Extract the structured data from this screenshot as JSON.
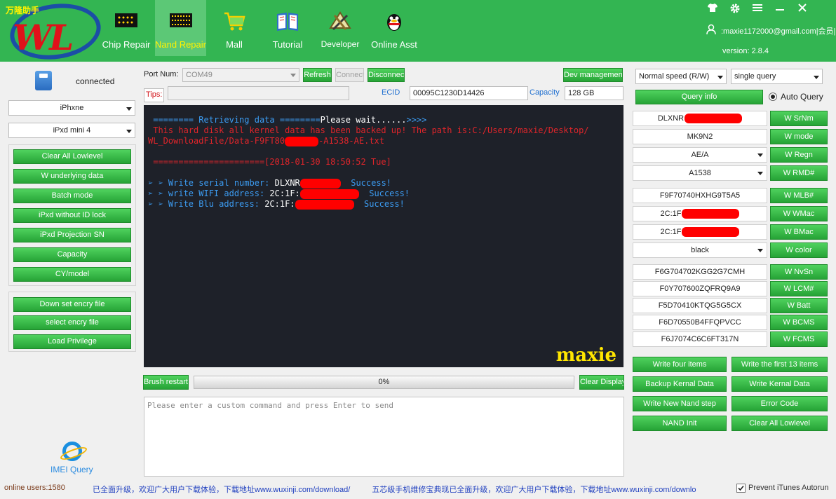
{
  "brand": {
    "cn_text": "万隆助手",
    "logo_text": "WL"
  },
  "nav": [
    {
      "label": "Chip Repair",
      "icon": "chip-icon"
    },
    {
      "label": "Nand Repair",
      "icon": "nand-chip-icon",
      "active": true
    },
    {
      "label": "Mall",
      "icon": "shopping-cart-icon"
    },
    {
      "label": "Tutorial",
      "icon": "book-icon"
    },
    {
      "label": "Developer",
      "icon": "developer-tools-icon"
    },
    {
      "label": "Online Asst",
      "icon": "qq-penguin-icon"
    }
  ],
  "header": {
    "user": ":maxie1172000@gmail.com|会员|",
    "version": "version: 2.8.4",
    "icons": [
      "shirt-icon",
      "gear-icon",
      "menu-icon",
      "minimize-icon",
      "close-icon"
    ]
  },
  "left": {
    "status": "connected",
    "device_select": "iPhxne",
    "model_select": "iPxd mini 4",
    "group1": [
      "Clear All Lowlevel",
      "W underlying data",
      "Batch mode",
      "iPxd without ID lock",
      "iPxd Projection SN",
      "Capacity",
      "CY/model"
    ],
    "group2": [
      "Down set encry file",
      "select encry file",
      "Load Privilege"
    ],
    "imei_label": "IMEI Query"
  },
  "toolbar": {
    "port_label": "Port Num:",
    "port_value": "COM49",
    "refresh": "Refresh",
    "connect": "Connect",
    "disconnect": "Disconnect",
    "dev_management": "Dev management",
    "tips_label": "Tips:",
    "ecid_label": "ECID",
    "ecid_value": "00095C1230D14426",
    "capacity_label": "Capacity",
    "capacity_value": "128 GB"
  },
  "console": {
    "line1_a": " ======== Retrieving data ========",
    "line1_b": "Please wait......",
    "line1_c": ">>>>",
    "line2": " This hard disk all kernel data has been backed up! The path is:C:/Users/maxie/Desktop/",
    "line3_a": "WL_DownloadFile/Data-F9FT80",
    "line3_b": "-A1538-AE.txt",
    "line4_a": " ======================",
    "line4_b": "[2018-01-30 18:50:52 Tue]",
    "w1_label": "Write serial number:",
    "w1_value": "DLXNR",
    "w2_label": "write WIFI address:",
    "w2_value": "2C:1F:",
    "w3_label": "Write Blu address:",
    "w3_value": "2C:1F:",
    "success": "Success!",
    "watermark": "maxie"
  },
  "progress": {
    "brush_restart": "Brush restart",
    "percent_text": "0%",
    "percent": 0,
    "clear_display": "Clear Display"
  },
  "command": {
    "placeholder": "Please enter a custom command and press Enter to send"
  },
  "right": {
    "speed_select": "Normal speed (R/W)",
    "query_select": "single query",
    "query_info": "Query info",
    "auto_query": "Auto Query",
    "rows": [
      {
        "value": "DLXNR",
        "button": "W SrNm",
        "redacted": true
      },
      {
        "value": "MK9N2",
        "button": "W mode"
      },
      {
        "value": "AE/A",
        "button": "W Regn",
        "dropdown": true
      },
      {
        "value": "A1538",
        "button": "W RMD#",
        "dropdown": true
      },
      {
        "value": "F9F70740HXHG9T5A5",
        "button": "W MLB#"
      },
      {
        "value": "2C:1F",
        "button": "W WMac",
        "redacted": true
      },
      {
        "value": "2C:1F",
        "button": "W BMac",
        "redacted": true
      },
      {
        "value": "black",
        "button": "W color",
        "dropdown": true
      },
      {
        "value": "F6G704702KGG2G7CMH",
        "button": "W NvSn"
      },
      {
        "value": "F0Y707600ZQFRQ9A9",
        "button": "W LCM#"
      },
      {
        "value": "F5D70410KTQG5G5CX",
        "button": "W Batt"
      },
      {
        "value": "F6D70550B4FFQPVCC",
        "button": "W BCMS"
      },
      {
        "value": "F6J7074C6C6FT317N",
        "button": "W FCMS"
      }
    ],
    "actions": [
      "Write four items",
      "Write the first 13 items",
      "Backup Kernal Data",
      "Write Kernal Data",
      "Write New Nand step",
      "Error Code",
      "NAND Init",
      "Clear All Lowlevel"
    ]
  },
  "statusbar": {
    "online": "online users:1580",
    "msg1": "已全面升级，欢迎广大用户下载体验，下载地址",
    "url1": "www.wuxinji.com/download/",
    "msg2": "五芯级手机维修宝典现已全面升级，欢迎广大用户下载体验，下载地址",
    "url2": "www.wuxinji.com/download/",
    "msg3": "五",
    "prevent_itunes": "Prevent iTunes Autorun",
    "prevent_checked": true
  }
}
